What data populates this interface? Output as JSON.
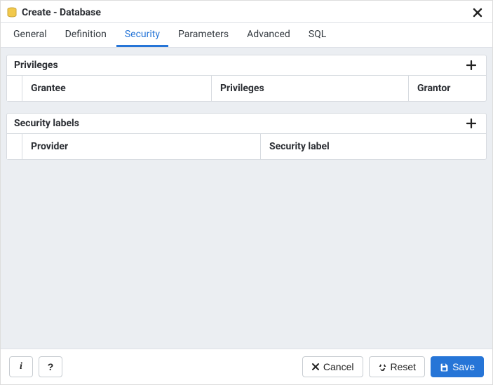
{
  "titlebar": {
    "title": "Create - Database"
  },
  "tabs": {
    "general": "General",
    "definition": "Definition",
    "security": "Security",
    "parameters": "Parameters",
    "advanced": "Advanced",
    "sql": "SQL",
    "active": "security"
  },
  "sections": {
    "privileges": {
      "title": "Privileges",
      "columns": {
        "grantee": "Grantee",
        "privileges": "Privileges",
        "grantor": "Grantor"
      },
      "rows": []
    },
    "securityLabels": {
      "title": "Security labels",
      "columns": {
        "provider": "Provider",
        "securityLabel": "Security label"
      },
      "rows": []
    }
  },
  "footer": {
    "info": "i",
    "help": "?",
    "cancel": "Cancel",
    "reset": "Reset",
    "save": "Save"
  }
}
